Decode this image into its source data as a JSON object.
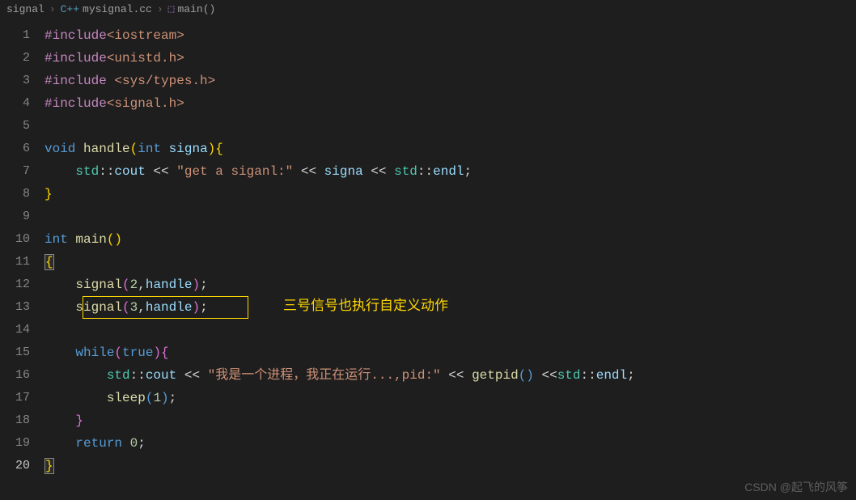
{
  "breadcrumb": {
    "folder": "signal",
    "file": "mysignal.cc",
    "symbol": "main()"
  },
  "lines": {
    "count": 20,
    "numbers": [
      "1",
      "2",
      "3",
      "4",
      "5",
      "6",
      "7",
      "8",
      "9",
      "10",
      "11",
      "12",
      "13",
      "14",
      "15",
      "16",
      "17",
      "18",
      "19",
      "20"
    ]
  },
  "code": {
    "l1_include": "#include",
    "l1_header": "<iostream>",
    "l2_include": "#include",
    "l2_header": "<unistd.h>",
    "l3_include": "#include",
    "l3_header": "<sys/types.h>",
    "l4_include": "#include",
    "l4_header": "<signal.h>",
    "l6_void": "void",
    "l6_handle": "handle",
    "l6_int": "int",
    "l6_signa": "signa",
    "l7_std": "std",
    "l7_cout": "cout",
    "l7_str": "\"get a siganl:\"",
    "l7_signa": "signa",
    "l7_endl": "endl",
    "l10_int": "int",
    "l10_main": "main",
    "l12_signal": "signal",
    "l12_num": "2",
    "l12_handle": "handle",
    "l13_signal": "signal",
    "l13_num": "3",
    "l13_handle": "handle",
    "l13_annotation": "三号信号也执行自定义动作",
    "l15_while": "while",
    "l15_true": "true",
    "l16_std": "std",
    "l16_cout": "cout",
    "l16_str": "\"我是一个进程，我正在运行...,pid:\"",
    "l16_getpid": "getpid",
    "l16_endl": "endl",
    "l17_sleep": "sleep",
    "l17_num": "1",
    "l19_return": "return",
    "l19_num": "0"
  },
  "watermark": "CSDN @起飞的风筝"
}
